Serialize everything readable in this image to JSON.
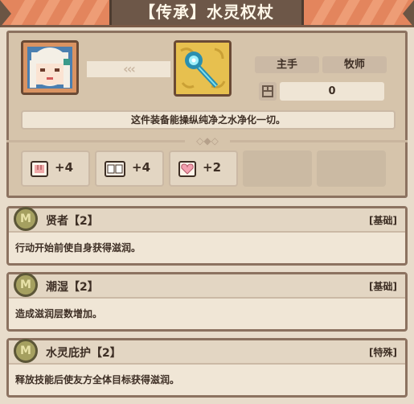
{
  "title": "【传承】水灵权杖",
  "item": {
    "icon": "scepter-icon",
    "slot_tag": "主手",
    "class_tag": "牧师",
    "level_value": "0",
    "description": "这件装备能操纵纯净之水净化一切。"
  },
  "stats": [
    {
      "icon": "fist-icon",
      "value": "+4"
    },
    {
      "icon": "book-icon",
      "value": "+4"
    },
    {
      "icon": "heart-icon",
      "value": "+2"
    }
  ],
  "skills": [
    {
      "name": "贤者【2】",
      "kind": "[基础]",
      "text": "行动开始前使自身获得滋润。"
    },
    {
      "name": "潮湿【2】",
      "kind": "[基础]",
      "text": "造成滋润层数增加。"
    },
    {
      "name": "水灵庇护【2】",
      "kind": "[特殊]",
      "text": "释放技能后使友方全体目标获得滋润。"
    }
  ],
  "colors": {
    "banner": "#e3855d",
    "panel": "#d6c4ab",
    "item_bg": "#e7c04f",
    "coin": "#a5a060"
  }
}
